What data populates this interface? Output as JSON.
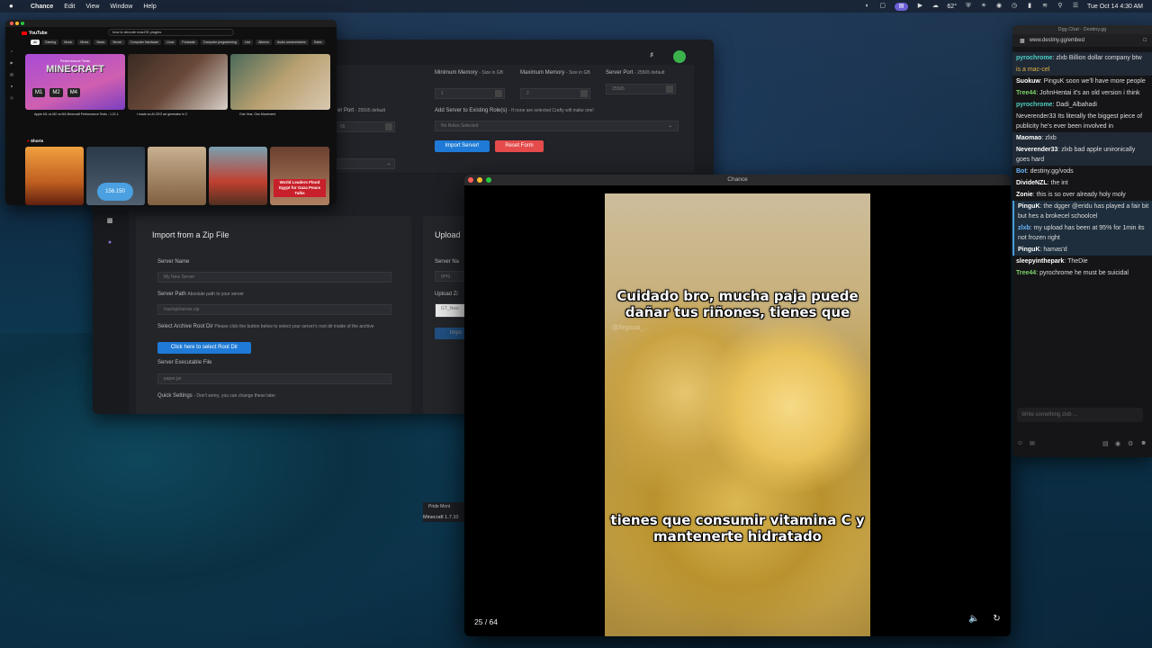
{
  "menubar": {
    "apple": "",
    "app": "Chance",
    "items": [
      "Edit",
      "View",
      "Window",
      "Help"
    ],
    "status_icon_label": "",
    "temp": "62°",
    "datetime": "Tue Oct 14  4:30 AM"
  },
  "youtube": {
    "logo": "YouTube",
    "search_text": "how to decode macOS plugins",
    "chips": [
      "All",
      "Gaming",
      "Music",
      "Mixes",
      "News",
      "Server",
      "Computer Hardware",
      "Linux",
      "Podcasts",
      "Computer programming",
      "Live",
      "Albums",
      "Audio commentaries",
      "Sales"
    ],
    "videos": [
      {
        "title": "Apple M1 vs M2 vs M4 Minecraft Performance Tests - 1.21.1",
        "thumb_text": "MINECRAFT",
        "thumb_sub": "Performance Tests"
      },
      {
        "title": "I made an AI CEO art generator in C",
        "thumb_text": "",
        "thumb_sub": ""
      },
      {
        "title": "One Year, One Movement",
        "thumb_text": "",
        "thumb_sub": ""
      }
    ],
    "shorts_label": "Shorts",
    "shorts": [
      "",
      "156.150",
      "",
      "",
      "World Leaders Flood Egypt for Gaza Peace Talks"
    ]
  },
  "crafty": {
    "min_memory_label": "Minimum Memory",
    "min_memory_hint": "- Size in GB",
    "max_memory_label": "Maximum Memory",
    "max_memory_hint": "- Size in GB",
    "server_port_label": "Server Port",
    "server_port_hint": "- 25565 default",
    "server_port_label2": "er Port",
    "server_port_hint2": "- 25565 default",
    "min_memory_value": "1",
    "max_memory_value": "2",
    "port_value": "25565",
    "port_value_left": "65",
    "roles_label": "Add Server to Existing Role(s)",
    "roles_hint": "- If none are selected Crafty will make one!",
    "roles_placeholder": "No Roles Selected",
    "import_button": "Import Server!",
    "reset_button": "Reset Form",
    "zip_title": "Import from a Zip File",
    "upload_title": "Upload",
    "server_name_label": "Server Name",
    "server_name_placeholder": "My New Server",
    "server_name_label_r": "Server Na",
    "server_name_value_r": "greg",
    "server_path_label": "Server Path",
    "server_path_hint": "Absolute path to your server",
    "server_path_placeholder": "/var/opt/server.zip",
    "upload_zip_label": "Upload Zi",
    "upload_zip_value": "GT_New",
    "upload_btn": "Impo",
    "archive_label": "Select Archive Root Dir",
    "archive_hint": "Please click the button below to select your server's root dir inside of the archive",
    "archive_button": "Click here to select Root Dir",
    "executable_label": "Server Executable File",
    "executable_placeholder": "paper.jar",
    "quick_label": "Quick Settings",
    "quick_hint": "- Don't worry, you can change these later",
    "minecraft_version": "Minecraft 1.7.10",
    "pride_text": "Pride Mont"
  },
  "player": {
    "title": "Chance",
    "caption_top": "Cuidado bro, mucha paja puede dañar tus riñones, tienes que",
    "caption_bottom": "tienes que consumir vitamina C y mantenerte hidratado",
    "watermark": "@/legosai_...",
    "counter": "25 / 64"
  },
  "chat": {
    "window_title": "Dgg Chat - Destiny.gg",
    "url": "www.destiny.gg/embed",
    "placeholder": "Write something zlxb ...",
    "messages": [
      {
        "user": "pyrochrome",
        "color": "#4fd1c5",
        "text": "zlxb Billion dollar company btw",
        "style": "hl"
      },
      {
        "user": "",
        "color": "#e0b341",
        "text": "is a mac-cel",
        "style": "hl"
      },
      {
        "user": "Suokuw",
        "color": "#ffffff",
        "text": "PinguK        soon we'll have more people",
        "style": ""
      },
      {
        "user": "Tree44",
        "color": "#7bd36a",
        "text": "JohnHentai it's an old version i think",
        "style": ""
      },
      {
        "user": "pyrochrome",
        "color": "#4fd1c5",
        "text": "Dadi_Albahadi",
        "style": ""
      },
      {
        "user": "",
        "color": "#ddd",
        "text": "Neverender33 Its literally the biggest piece of publicity he's ever been involved in",
        "style": ""
      },
      {
        "user": "Maomao",
        "color": "#ffffff",
        "text": "zlxb",
        "style": "hl"
      },
      {
        "user": "Neverender33",
        "color": "#ffffff",
        "text": "zlxb bad apple unironically goes hard",
        "style": "hl"
      },
      {
        "user": "Bot",
        "color": "#6ab7ff",
        "text": "destiny.gg/vods",
        "style": ""
      },
      {
        "user": "DivideNZL",
        "color": "#ffffff",
        "text": "the int",
        "style": ""
      },
      {
        "user": "Zonie",
        "color": "#ffffff",
        "text": "this is so over already holy moly",
        "style": ""
      },
      {
        "user": "PinguK",
        "color": "#ffffff",
        "text": "the dgger @eridu has played a fair bit but hes a brokecel schoolcel",
        "style": "hl2"
      },
      {
        "user": "zlxb",
        "color": "#6ab7ff",
        "text": "my upload has been at 95% for 1min its not frozen right",
        "style": "hl2"
      },
      {
        "user": "PinguK",
        "color": "#ffffff",
        "text": "hamas'd",
        "style": "hl2"
      },
      {
        "user": "sleepyinthepark",
        "color": "#ffffff",
        "text": "TheDie",
        "style": ""
      },
      {
        "user": "Tree44",
        "color": "#7bd36a",
        "text": "pyrochrome he must be suicidal",
        "style": ""
      }
    ]
  }
}
